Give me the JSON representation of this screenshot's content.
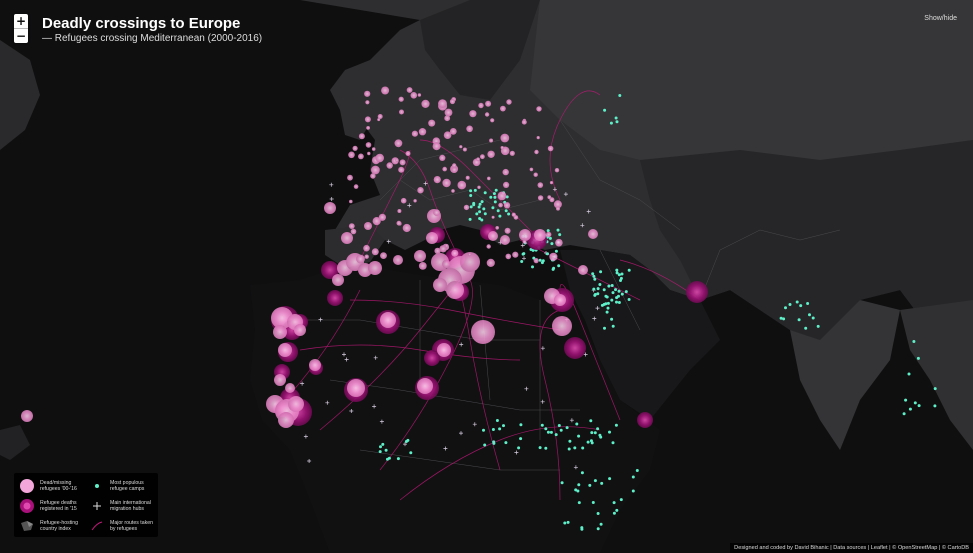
{
  "header": {
    "title": "Deadly crossings to Europe",
    "subtitle": "— Refugees crossing Mediterranean (2000-2016)",
    "show_hide": "Show/hide"
  },
  "zoom": {
    "in_label": "+",
    "out_label": "−"
  },
  "legend": {
    "items": [
      {
        "icon": "large-pink-circle",
        "label": "Dead/missing refugees '00-'16"
      },
      {
        "icon": "magenta-gradient-circle",
        "label": "Refugee deaths registered in '15"
      },
      {
        "icon": "map-choropleth-icon",
        "label": "Refugee-hosting country index"
      },
      {
        "icon": "teal-dot",
        "label": "Most populous refugee camps"
      },
      {
        "icon": "cross-hub",
        "label": "Main international migration hubs"
      },
      {
        "icon": "route-line",
        "label": "Major routes taken by refugees"
      }
    ]
  },
  "attribution": "Designed and coded by David Bihanic | Data sources | Leaflet | © OpenStreetMap | © CartoDB",
  "colors": {
    "background": "#0f0f10",
    "land": "#2f2f31",
    "land_dark": "#1b1b1c",
    "africa": "#121213",
    "deaths_pink": "#f08fcf",
    "deaths_magenta": "#a8107a",
    "camps_teal": "#5ef0c8",
    "routes": "#c2187a"
  }
}
